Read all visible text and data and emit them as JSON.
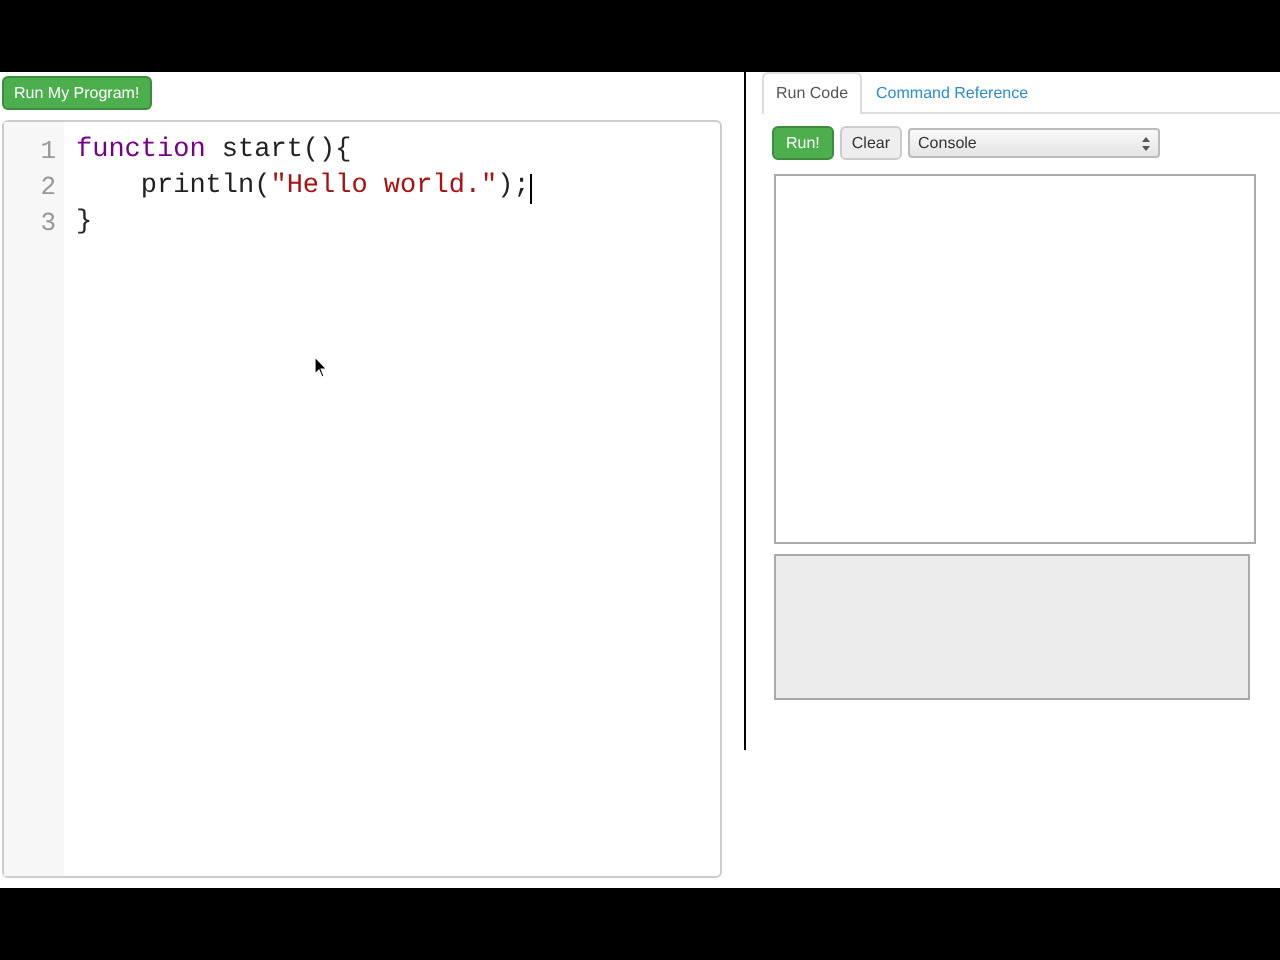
{
  "run_program_button": "Run My Program!",
  "editor": {
    "lines": [
      {
        "number": "1",
        "caret": false,
        "tokens": [
          {
            "kind": "keyword",
            "text": "function"
          },
          {
            "kind": "plain",
            "text": " start(){"
          }
        ]
      },
      {
        "number": "2",
        "caret": true,
        "tokens": [
          {
            "kind": "plain",
            "text": "    println("
          },
          {
            "kind": "string",
            "text": "\"Hello world.\""
          },
          {
            "kind": "plain",
            "text": ");"
          }
        ]
      },
      {
        "number": "3",
        "caret": false,
        "tokens": [
          {
            "kind": "plain",
            "text": "}"
          }
        ]
      }
    ]
  },
  "tabs": [
    {
      "label": "Run Code",
      "selected": true
    },
    {
      "label": "Command Reference",
      "selected": false
    }
  ],
  "toolbar": {
    "run_button": "Run!",
    "clear_button": "Clear",
    "output_select": "Console"
  }
}
